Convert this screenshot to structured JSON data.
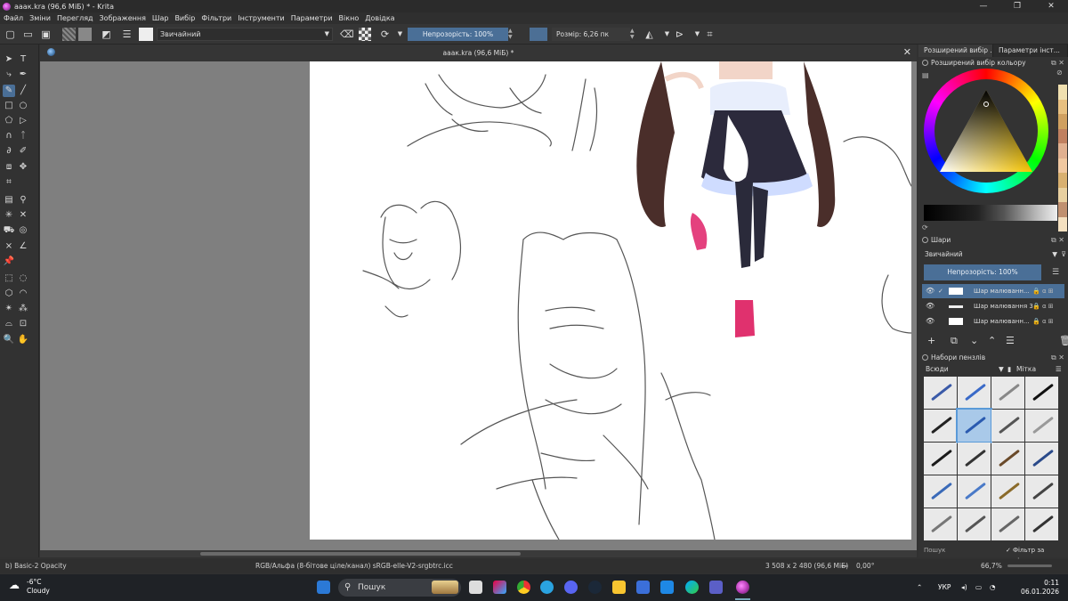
{
  "window": {
    "title": "ааак.kra (96,6 МіБ) * - Krita",
    "buttons": {
      "minimize": "—",
      "maximize": "❐",
      "close": "✕"
    }
  },
  "menu": [
    "Файл",
    "Зміни",
    "Перегляд",
    "Зображення",
    "Шар",
    "Вибір",
    "Фільтри",
    "Інструменти",
    "Параметри",
    "Вікно",
    "Довідка"
  ],
  "toolbar": {
    "blend_mode": "Звичайний",
    "opacity_label": "Непрозорість: 100%",
    "size_label": "Розмір: 6,26 пк",
    "accent_color": "#4a6f97"
  },
  "document": {
    "tab_title": "ааак.kra (96,6 МіБ) *",
    "close": "✕"
  },
  "docker": {
    "tabs": [
      "Розширений вибір ...",
      "Параметри інст..."
    ],
    "color_panel_title": "Розширений вибір кольору",
    "layers_panel_title": "Шари",
    "layers_blend_mode": "Звичайний",
    "layers_opacity": "Непрозорість: 100%",
    "layers": [
      {
        "name": "Шар малюванн...",
        "selected": true
      },
      {
        "name": "Шар малювання 3",
        "selected": false
      },
      {
        "name": "Шар малюванн...",
        "selected": false
      }
    ],
    "brush_panel_title": "Набори пензлів",
    "brush_filter": "Всюди",
    "brush_tag": "Мітка",
    "brush_search_placeholder": "Пошук",
    "brush_tag_filter": "Фільтр за міткою"
  },
  "status": {
    "brush": "b) Basic-2 Opacity",
    "color_profile": "RGB/Альфа (8-бітове ціле/канал)  sRGB-elle-V2-srgbtrc.icc",
    "dimensions": "3 508 x 2 480 (96,6 МіБ)",
    "rotation": "0,00°",
    "zoom": "66,7%"
  },
  "taskbar": {
    "temperature": "-6°C",
    "weather": "Cloudy",
    "search_placeholder": "Пошук",
    "language": "УКР",
    "time": "0:11",
    "date": "06.01.2026"
  }
}
